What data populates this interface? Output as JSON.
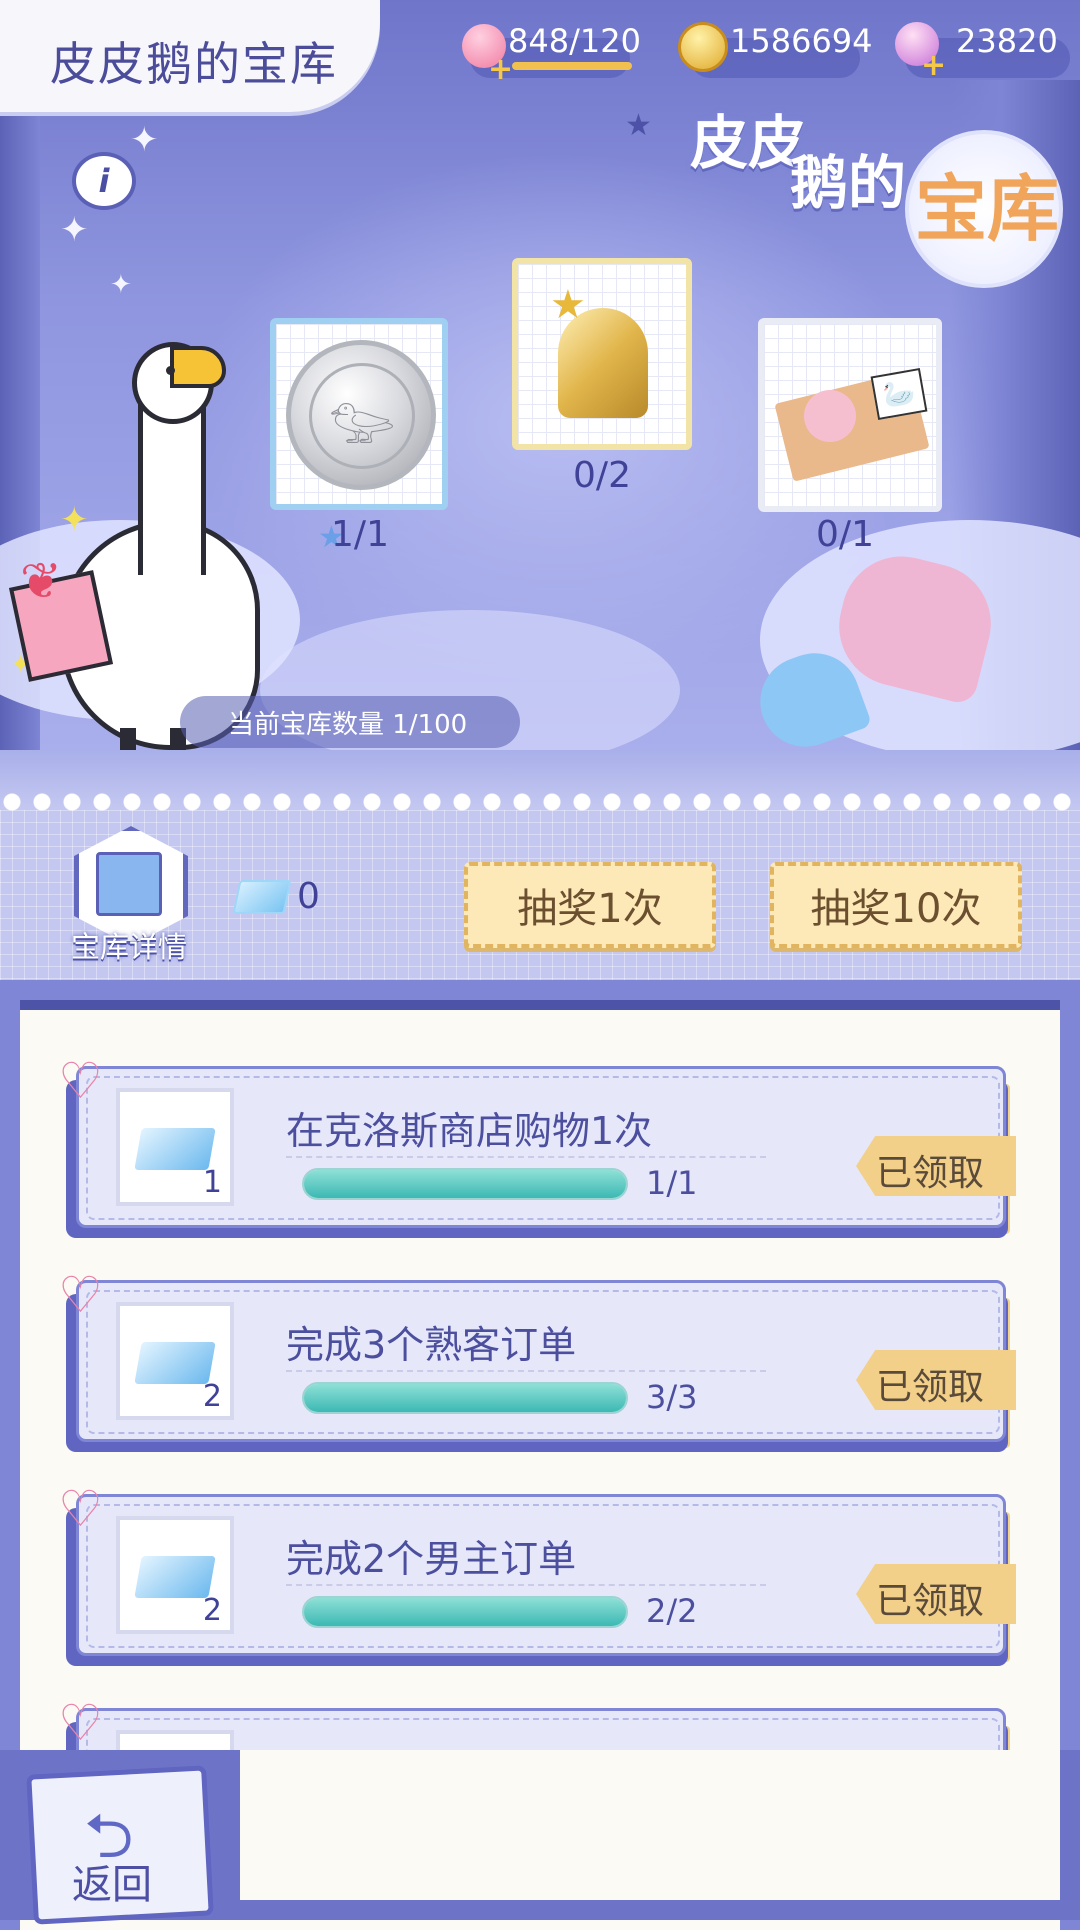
{
  "header": {
    "title": "皮皮鹅的宝库",
    "stamina": "848/120",
    "coins": "1586694",
    "diamonds": "23820"
  },
  "logo": {
    "line1": "皮皮",
    "line2": "鹅的",
    "badge": "宝库"
  },
  "prizes": [
    {
      "name": "swan-coin",
      "count": "1/1"
    },
    {
      "name": "golden-bell",
      "count": "0/2"
    },
    {
      "name": "character-ticket",
      "count": "0/1"
    }
  ],
  "banner": {
    "vault_count": "当前宝库数量  1/100"
  },
  "actions": {
    "detail_label": "宝库详情",
    "ticket_count": "0",
    "draw_one": "抽奖1次",
    "draw_ten": "抽奖10次"
  },
  "tasks": [
    {
      "title": "在克洛斯商店购物1次",
      "reward_qty": "1",
      "progress_text": "1/1",
      "progress": 1.0,
      "status": "已领取"
    },
    {
      "title": "完成3个熟客订单",
      "reward_qty": "2",
      "progress_text": "3/3",
      "progress": 1.0,
      "status": "已领取"
    },
    {
      "title": "完成2个男主订单",
      "reward_qty": "2",
      "progress_text": "2/2",
      "progress": 1.0,
      "status": "已领取"
    }
  ],
  "footer": {
    "back_label": "返回"
  },
  "colors": {
    "primary": "#6d74c8",
    "accent_gold": "#f2d08a",
    "progress_teal": "#3cb9b3"
  }
}
